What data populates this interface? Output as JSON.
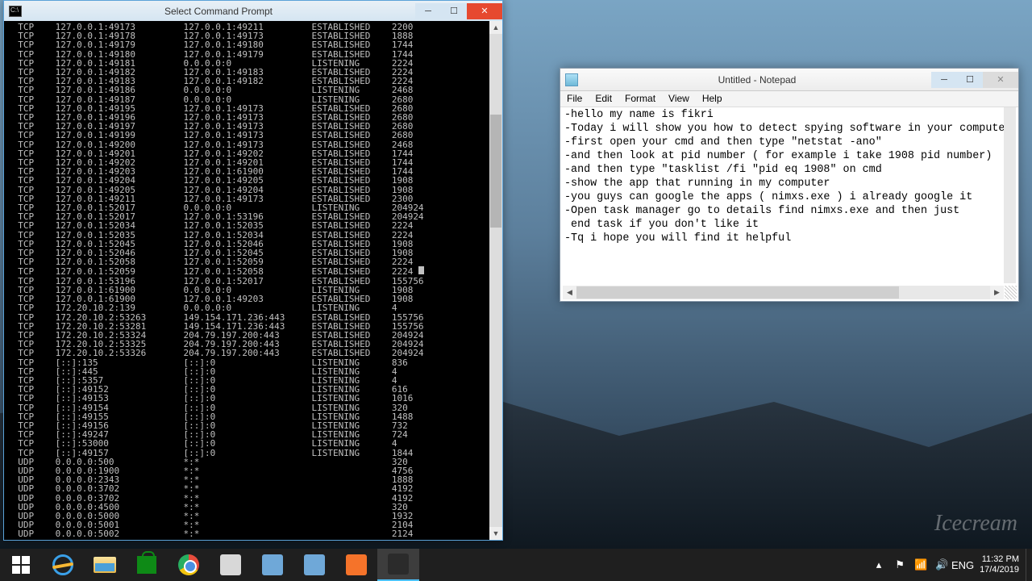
{
  "cmd": {
    "title": "Select Command Prompt",
    "rows": [
      [
        "TCP",
        "127.0.0.1:49173",
        "127.0.0.1:49211",
        "ESTABLISHED",
        "2200"
      ],
      [
        "TCP",
        "127.0.0.1:49178",
        "127.0.0.1:49173",
        "ESTABLISHED",
        "1888"
      ],
      [
        "TCP",
        "127.0.0.1:49179",
        "127.0.0.1:49180",
        "ESTABLISHED",
        "1744"
      ],
      [
        "TCP",
        "127.0.0.1:49180",
        "127.0.0.1:49179",
        "ESTABLISHED",
        "1744"
      ],
      [
        "TCP",
        "127.0.0.1:49181",
        "0.0.0.0:0",
        "LISTENING",
        "2224"
      ],
      [
        "TCP",
        "127.0.0.1:49182",
        "127.0.0.1:49183",
        "ESTABLISHED",
        "2224"
      ],
      [
        "TCP",
        "127.0.0.1:49183",
        "127.0.0.1:49182",
        "ESTABLISHED",
        "2224"
      ],
      [
        "TCP",
        "127.0.0.1:49186",
        "0.0.0.0:0",
        "LISTENING",
        "2468"
      ],
      [
        "TCP",
        "127.0.0.1:49187",
        "0.0.0.0:0",
        "LISTENING",
        "2680"
      ],
      [
        "TCP",
        "127.0.0.1:49195",
        "127.0.0.1:49173",
        "ESTABLISHED",
        "2680"
      ],
      [
        "TCP",
        "127.0.0.1:49196",
        "127.0.0.1:49173",
        "ESTABLISHED",
        "2680"
      ],
      [
        "TCP",
        "127.0.0.1:49197",
        "127.0.0.1:49173",
        "ESTABLISHED",
        "2680"
      ],
      [
        "TCP",
        "127.0.0.1:49199",
        "127.0.0.1:49173",
        "ESTABLISHED",
        "2680"
      ],
      [
        "TCP",
        "127.0.0.1:49200",
        "127.0.0.1:49173",
        "ESTABLISHED",
        "2468"
      ],
      [
        "TCP",
        "127.0.0.1:49201",
        "127.0.0.1:49202",
        "ESTABLISHED",
        "1744"
      ],
      [
        "TCP",
        "127.0.0.1:49202",
        "127.0.0.1:49201",
        "ESTABLISHED",
        "1744"
      ],
      [
        "TCP",
        "127.0.0.1:49203",
        "127.0.0.1:61900",
        "ESTABLISHED",
        "1744"
      ],
      [
        "TCP",
        "127.0.0.1:49204",
        "127.0.0.1:49205",
        "ESTABLISHED",
        "1908"
      ],
      [
        "TCP",
        "127.0.0.1:49205",
        "127.0.0.1:49204",
        "ESTABLISHED",
        "1908"
      ],
      [
        "TCP",
        "127.0.0.1:49211",
        "127.0.0.1:49173",
        "ESTABLISHED",
        "2300"
      ],
      [
        "TCP",
        "127.0.0.1:52017",
        "0.0.0.0:0",
        "LISTENING",
        "204924"
      ],
      [
        "TCP",
        "127.0.0.1:52017",
        "127.0.0.1:53196",
        "ESTABLISHED",
        "204924"
      ],
      [
        "TCP",
        "127.0.0.1:52034",
        "127.0.0.1:52035",
        "ESTABLISHED",
        "2224"
      ],
      [
        "TCP",
        "127.0.0.1:52035",
        "127.0.0.1:52034",
        "ESTABLISHED",
        "2224"
      ],
      [
        "TCP",
        "127.0.0.1:52045",
        "127.0.0.1:52046",
        "ESTABLISHED",
        "1908"
      ],
      [
        "TCP",
        "127.0.0.1:52046",
        "127.0.0.1:52045",
        "ESTABLISHED",
        "1908"
      ],
      [
        "TCP",
        "127.0.0.1:52058",
        "127.0.0.1:52059",
        "ESTABLISHED",
        "2224"
      ],
      [
        "TCP",
        "127.0.0.1:52059",
        "127.0.0.1:52058",
        "ESTABLISHED",
        "2224"
      ],
      [
        "TCP",
        "127.0.0.1:53196",
        "127.0.0.1:52017",
        "ESTABLISHED",
        "155756"
      ],
      [
        "TCP",
        "127.0.0.1:61900",
        "0.0.0.0:0",
        "LISTENING",
        "1908"
      ],
      [
        "TCP",
        "127.0.0.1:61900",
        "127.0.0.1:49203",
        "ESTABLISHED",
        "1908"
      ],
      [
        "TCP",
        "172.20.10.2:139",
        "0.0.0.0:0",
        "LISTENING",
        "4"
      ],
      [
        "TCP",
        "172.20.10.2:53263",
        "149.154.171.236:443",
        "ESTABLISHED",
        "155756"
      ],
      [
        "TCP",
        "172.20.10.2:53281",
        "149.154.171.236:443",
        "ESTABLISHED",
        "155756"
      ],
      [
        "TCP",
        "172.20.10.2:53324",
        "204.79.197.200:443",
        "ESTABLISHED",
        "204924"
      ],
      [
        "TCP",
        "172.20.10.2:53325",
        "204.79.197.200:443",
        "ESTABLISHED",
        "204924"
      ],
      [
        "TCP",
        "172.20.10.2:53326",
        "204.79.197.200:443",
        "ESTABLISHED",
        "204924"
      ],
      [
        "TCP",
        "[::]:135",
        "[::]:0",
        "LISTENING",
        "836"
      ],
      [
        "TCP",
        "[::]:445",
        "[::]:0",
        "LISTENING",
        "4"
      ],
      [
        "TCP",
        "[::]:5357",
        "[::]:0",
        "LISTENING",
        "4"
      ],
      [
        "TCP",
        "[::]:49152",
        "[::]:0",
        "LISTENING",
        "616"
      ],
      [
        "TCP",
        "[::]:49153",
        "[::]:0",
        "LISTENING",
        "1016"
      ],
      [
        "TCP",
        "[::]:49154",
        "[::]:0",
        "LISTENING",
        "320"
      ],
      [
        "TCP",
        "[::]:49155",
        "[::]:0",
        "LISTENING",
        "1488"
      ],
      [
        "TCP",
        "[::]:49156",
        "[::]:0",
        "LISTENING",
        "732"
      ],
      [
        "TCP",
        "[::]:49247",
        "[::]:0",
        "LISTENING",
        "724"
      ],
      [
        "TCP",
        "[::]:53000",
        "[::]:0",
        "LISTENING",
        "4"
      ],
      [
        "TCP",
        "[::]:49157",
        "[::]:0",
        "LISTENING",
        "1844"
      ],
      [
        "UDP",
        "0.0.0.0:500",
        "*:*",
        "",
        "320"
      ],
      [
        "UDP",
        "0.0.0.0:1900",
        "*:*",
        "",
        "4756"
      ],
      [
        "UDP",
        "0.0.0.0:2343",
        "*:*",
        "",
        "1888"
      ],
      [
        "UDP",
        "0.0.0.0:3702",
        "*:*",
        "",
        "4192"
      ],
      [
        "UDP",
        "0.0.0.0:3702",
        "*:*",
        "",
        "4192"
      ],
      [
        "UDP",
        "0.0.0.0:4500",
        "*:*",
        "",
        "320"
      ],
      [
        "UDP",
        "0.0.0.0:5000",
        "*:*",
        "",
        "1932"
      ],
      [
        "UDP",
        "0.0.0.0:5001",
        "*:*",
        "",
        "2104"
      ],
      [
        "UDP",
        "0.0.0.0:5002",
        "*:*",
        "",
        "2124"
      ]
    ]
  },
  "notepad": {
    "title": "Untitled - Notepad",
    "menu": {
      "file": "File",
      "edit": "Edit",
      "format": "Format",
      "view": "View",
      "help": "Help"
    },
    "lines": [
      "-hello my name is fikri",
      "-Today i will show you how to detect spying software in your computer",
      "-first open your cmd and then type \"netstat -ano\"",
      "-and then look at pid number ( for example i take 1908 pid number)",
      "-and then type \"tasklist /fi \"pid eq 1908\" on cmd",
      "-show the app that running in my computer",
      "-you guys can google the apps ( nimxs.exe ) i already google it",
      "-Open task manager go to details find nimxs.exe and then just",
      " end task if you don't like it",
      "-Tq i hope you will find it helpful"
    ]
  },
  "taskbar": {
    "lang": "ENG",
    "time": "11:32 PM",
    "date": "17/4/2019"
  },
  "watermark": "Icecream"
}
